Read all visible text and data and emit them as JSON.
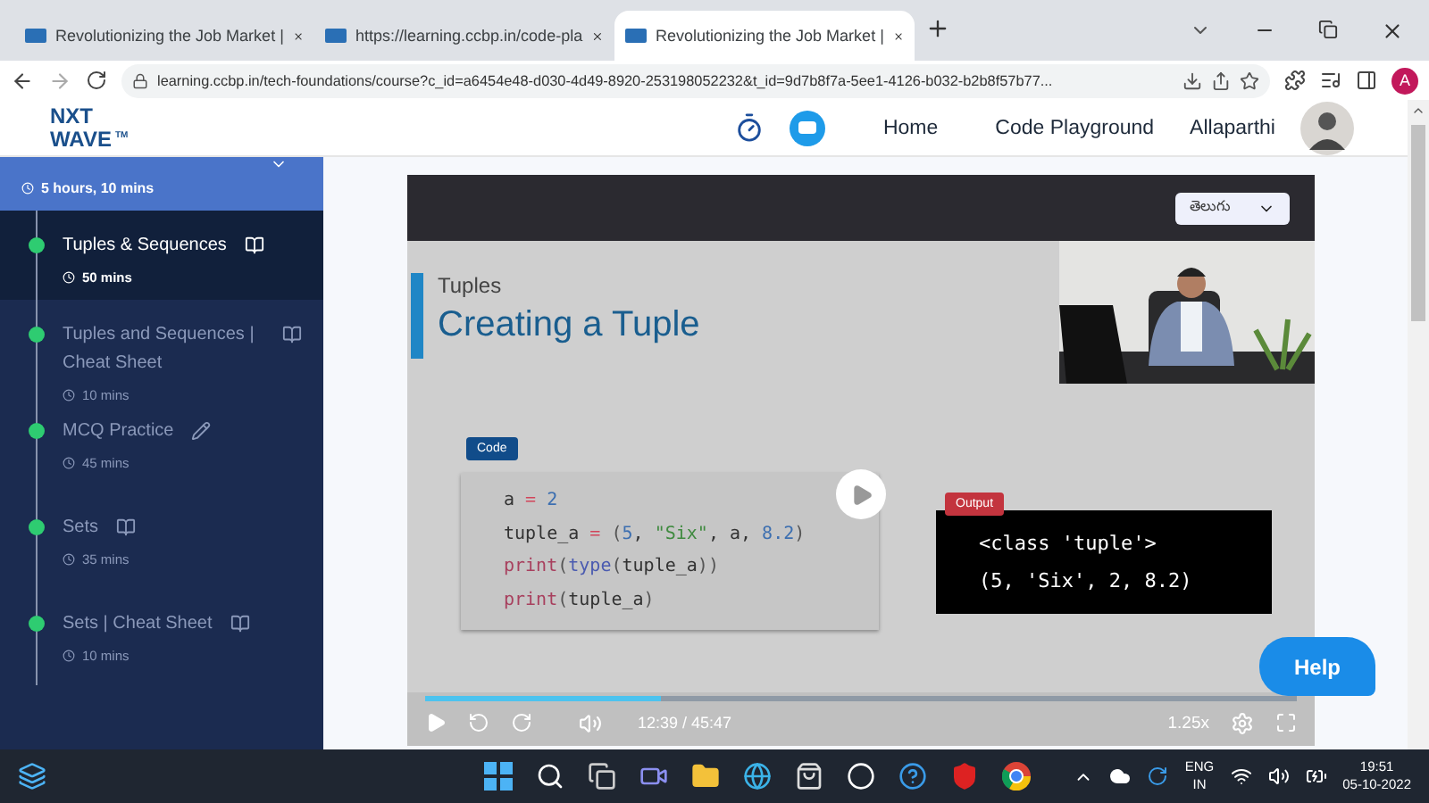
{
  "browser": {
    "tabs": [
      {
        "title": "Revolutionizing the Job Market |",
        "selected": false
      },
      {
        "title": "https://learning.ccbp.in/code-pla",
        "selected": false
      },
      {
        "title": "Revolutionizing the Job Market |",
        "selected": true
      }
    ],
    "url": "learning.ccbp.in/tech-foundations/course?c_id=a6454e48-d030-4d49-8920-253198052232&t_id=9d7b8f7a-5ee1-4126-b032-b2b8f57b77...",
    "profile_initial": "A"
  },
  "header": {
    "logo_top": "NXT",
    "logo_bottom": "WAVE",
    "logo_mark": "TM",
    "nav": [
      "Home",
      "Code Playground"
    ],
    "user": "Allaparthi"
  },
  "sidebar": {
    "total_time": "5 hours, 10 mins",
    "items": [
      {
        "title": "Tuples & Sequences",
        "duration": "50 mins",
        "kind": "reading",
        "selected": true,
        "completed": true
      },
      {
        "title": "Tuples and Sequences | Cheat Sheet",
        "duration": "10 mins",
        "kind": "reading",
        "selected": false,
        "completed": true
      },
      {
        "title": "MCQ Practice",
        "duration": "45 mins",
        "kind": "practice",
        "selected": false,
        "completed": true
      },
      {
        "title": "Sets",
        "duration": "35 mins",
        "kind": "reading",
        "selected": false,
        "completed": true
      },
      {
        "title": "Sets | Cheat Sheet",
        "duration": "10 mins",
        "kind": "reading",
        "selected": false,
        "completed": true
      }
    ]
  },
  "video": {
    "language": "తెలుగు",
    "slide": {
      "subtitle": "Tuples",
      "title": "Creating a Tuple",
      "code_label": "Code",
      "code": [
        [
          {
            "t": "a ",
            "kind": "name"
          },
          {
            "t": "= ",
            "kind": "op"
          },
          {
            "t": "2",
            "kind": "num"
          }
        ],
        [
          {
            "t": "tuple_a ",
            "kind": "name"
          },
          {
            "t": "= ",
            "kind": "op"
          },
          {
            "t": "(",
            "kind": "paren"
          },
          {
            "t": "5",
            "kind": "num"
          },
          {
            "t": ", ",
            "kind": "name"
          },
          {
            "t": "\"Six\"",
            "kind": "str"
          },
          {
            "t": ", a, ",
            "kind": "name"
          },
          {
            "t": "8.2",
            "kind": "num"
          },
          {
            "t": ")",
            "kind": "paren"
          }
        ],
        [
          {
            "t": "print",
            "kind": "func"
          },
          {
            "t": "(",
            "kind": "paren"
          },
          {
            "t": "type",
            "kind": "builtin"
          },
          {
            "t": "(",
            "kind": "paren"
          },
          {
            "t": "tuple_a",
            "kind": "name"
          },
          {
            "t": "))",
            "kind": "paren"
          }
        ],
        [
          {
            "t": "print",
            "kind": "func"
          },
          {
            "t": "(",
            "kind": "paren"
          },
          {
            "t": "tuple_a",
            "kind": "name"
          },
          {
            "t": ")",
            "kind": "paren"
          }
        ]
      ],
      "output_label": "Output",
      "output": [
        "<class 'tuple'>",
        "(5, 'Six', 2, 8.2)"
      ]
    },
    "progress": {
      "level": 0.27
    },
    "time": "12:39 / 45:47",
    "speed": "1.25x"
  },
  "help": "Help",
  "taskbar": {
    "language": [
      "ENG",
      "IN"
    ],
    "time": "19:51",
    "date": "05-10-2022"
  }
}
